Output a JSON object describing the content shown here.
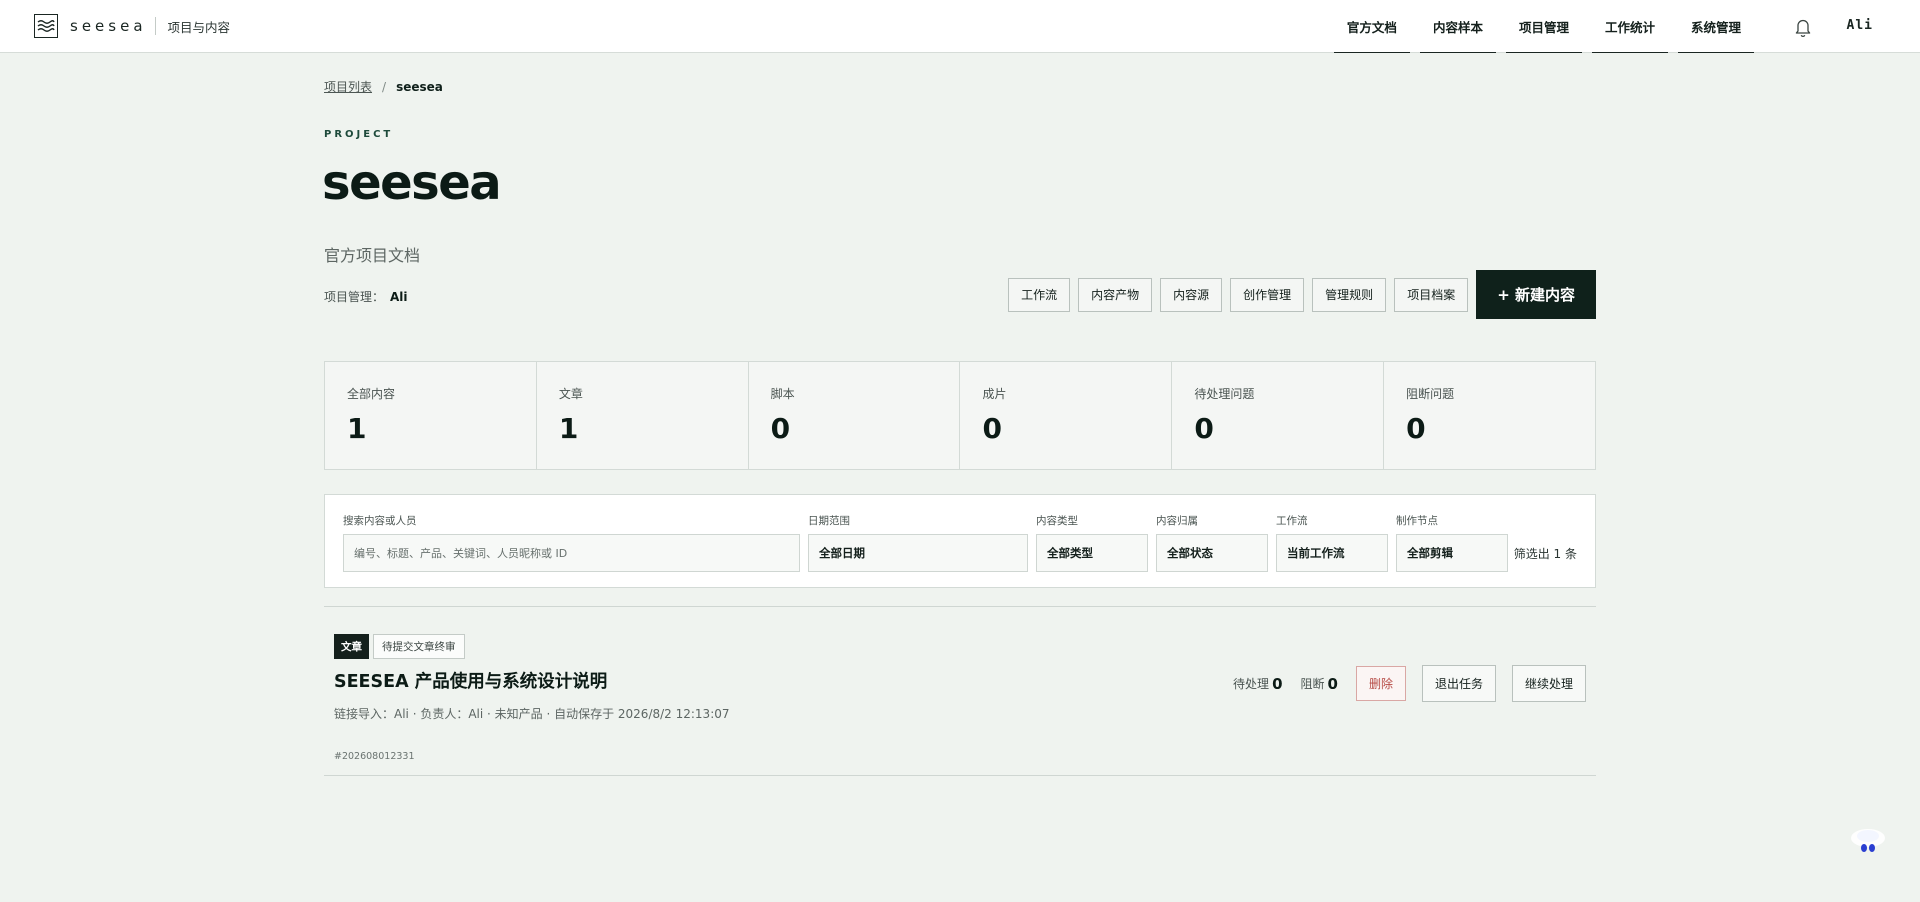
{
  "brand": {
    "name": "seesea",
    "subtitle": "项目与内容"
  },
  "nav": [
    {
      "label": "官方文档"
    },
    {
      "label": "内容样本"
    },
    {
      "label": "项目管理"
    },
    {
      "label": "工作统计"
    },
    {
      "label": "系统管理"
    }
  ],
  "user": "Ali",
  "breadcrumb": {
    "parent": "项目列表",
    "separator": "/",
    "current": "seesea"
  },
  "project": {
    "eyebrow": "PROJECT",
    "title": "seesea",
    "description": "官方项目文档",
    "manager_label": "项目管理：",
    "manager_name": "Ali"
  },
  "actions": [
    {
      "label": "工作流"
    },
    {
      "label": "内容产物"
    },
    {
      "label": "内容源"
    },
    {
      "label": "创作管理"
    },
    {
      "label": "管理规则"
    },
    {
      "label": "项目档案"
    }
  ],
  "new_content_label": "+ 新建内容",
  "stats": [
    {
      "label": "全部内容",
      "value": "1"
    },
    {
      "label": "文章",
      "value": "1"
    },
    {
      "label": "脚本",
      "value": "0"
    },
    {
      "label": "成片",
      "value": "0"
    },
    {
      "label": "待处理问题",
      "value": "0"
    },
    {
      "label": "阻断问题",
      "value": "0"
    }
  ],
  "filters": {
    "search": {
      "label": "搜索内容或人员",
      "placeholder": "编号、标题、产品、关键词、人员昵称或 ID"
    },
    "date": {
      "label": "日期范围",
      "value": "全部日期"
    },
    "type": {
      "label": "内容类型",
      "value": "全部类型"
    },
    "owner": {
      "label": "内容归属",
      "value": "全部状态"
    },
    "workflow": {
      "label": "工作流",
      "value": "当前工作流"
    },
    "node": {
      "label": "制作节点",
      "value": "全部剪辑"
    },
    "result": "筛选出 1 条"
  },
  "item": {
    "type_tag": "文章",
    "status_tag": "待提交文章终审",
    "title": "SEESEA 产品使用与系统设计说明",
    "meta": "链接导入：Ali · 负责人：Ali · 未知产品 · 自动保存于 2026/8/2 12:13:07",
    "id": "#202608012331",
    "pending_label": "待处理",
    "pending_value": "0",
    "blocked_label": "阻断",
    "blocked_value": "0",
    "delete_label": "删除",
    "exit_label": "退出任务",
    "continue_label": "继续处理"
  },
  "colors": {
    "accent_dark": "#0f211b",
    "background": "#eff3ef",
    "danger": "#b64a44"
  }
}
